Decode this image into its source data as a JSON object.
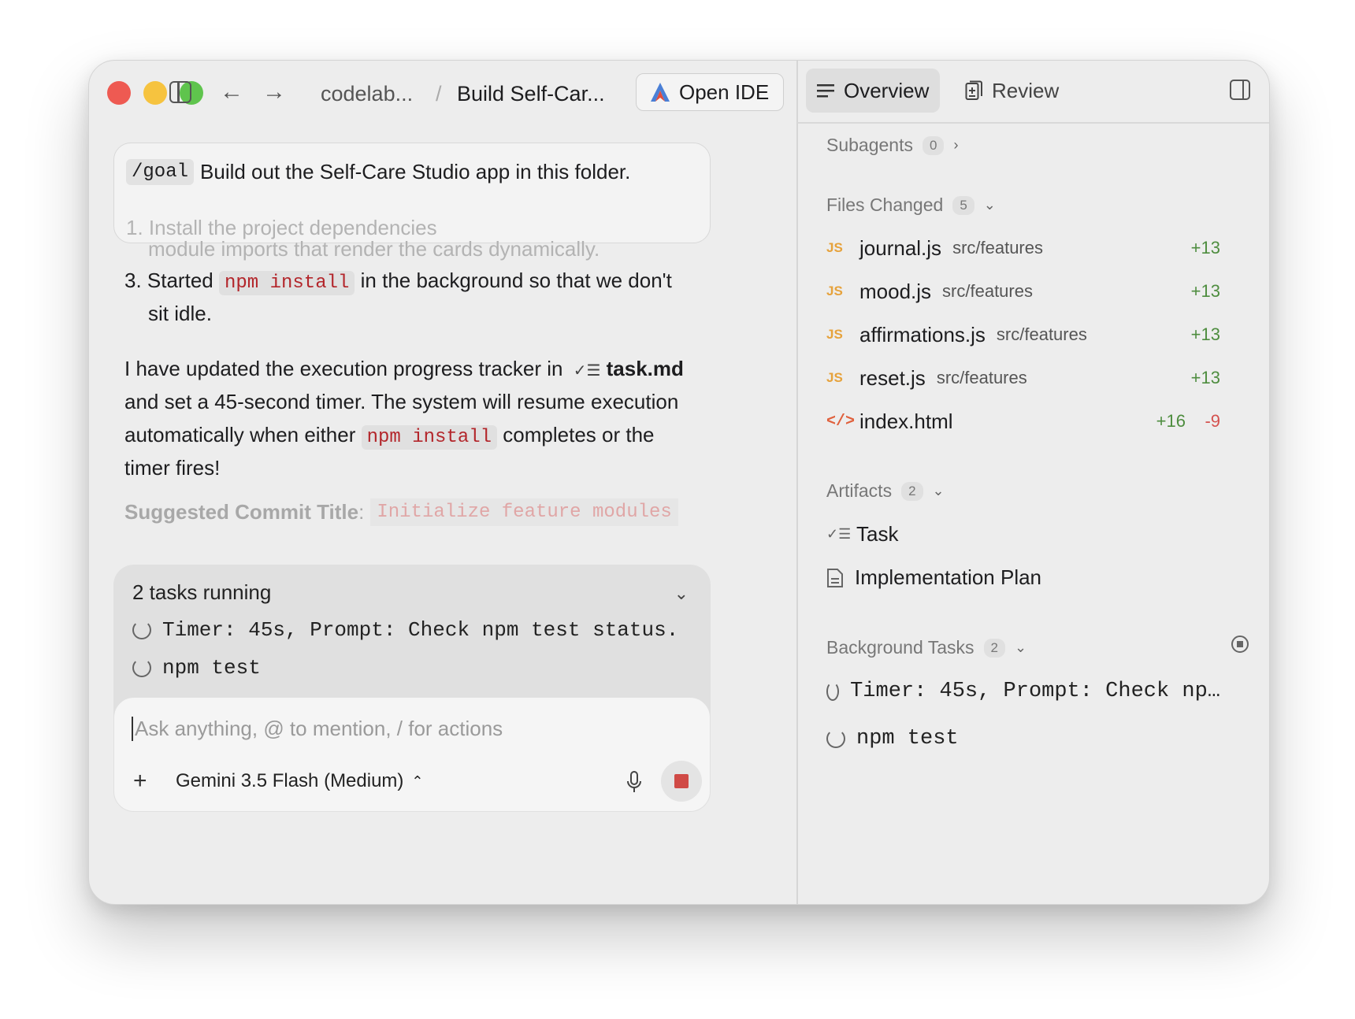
{
  "titlebar": {
    "back_icon": "arrow-left-icon",
    "forward_icon": "arrow-right-icon",
    "project": "codelab...",
    "separator": "/",
    "conversation_title": "Build Self-Car...",
    "open_ide_label": "Open IDE"
  },
  "right_tabs": {
    "overview": "Overview",
    "review": "Review"
  },
  "chat": {
    "goal_command": "/goal",
    "goal_text": "Build out the Self-Care Studio app in this folder.",
    "goal_next_line": "1. Install the project dependencies",
    "faded_line": "module imports that render the cards dynamically.",
    "step3_prefix": "3. Started",
    "step3_code": "npm install",
    "step3_suffix": "in the background so that we don't",
    "step3_cont": "sit idle.",
    "para_part1": "I have updated the execution progress tracker in",
    "para_file": "task.md",
    "para_part2": "and set a 45-second timer. The system will resume execution",
    "para_part3_prefix": "automatically when either",
    "para_code": "npm install",
    "para_part3_suffix": "completes or the",
    "para_part4": "timer fires!",
    "commit_label": "Suggested Commit Title",
    "commit_colon": ":",
    "commit_value": "Initialize feature modules"
  },
  "tasks_panel": {
    "title": "2 tasks running",
    "tasks": [
      "Timer: 45s, Prompt: Check npm test status.",
      "npm test"
    ]
  },
  "input": {
    "placeholder": "Ask anything, @ to mention, / for actions",
    "model": "Gemini 3.5 Flash (Medium)",
    "plus": "+"
  },
  "overview": {
    "subagents": {
      "label": "Subagents",
      "count": "0"
    },
    "files_changed": {
      "label": "Files Changed",
      "count": "5",
      "files": [
        {
          "icon": "JS",
          "name": "journal.js",
          "path": "src/features",
          "add": "+13",
          "del": ""
        },
        {
          "icon": "JS",
          "name": "mood.js",
          "path": "src/features",
          "add": "+13",
          "del": ""
        },
        {
          "icon": "JS",
          "name": "affirmations.js",
          "path": "src/features",
          "add": "+13",
          "del": ""
        },
        {
          "icon": "JS",
          "name": "reset.js",
          "path": "src/features",
          "add": "+13",
          "del": ""
        },
        {
          "icon": "</>",
          "name": "index.html",
          "path": "",
          "add": "+16",
          "del": "-9"
        }
      ]
    },
    "artifacts": {
      "label": "Artifacts",
      "count": "2",
      "items": [
        "Task",
        "Implementation Plan"
      ]
    },
    "background_tasks": {
      "label": "Background Tasks",
      "count": "2",
      "items": [
        "Timer: 45s, Prompt: Check np…",
        "npm test"
      ]
    }
  },
  "colors": {
    "additions": "#4e8d3f",
    "deletions": "#d4524f",
    "js_icon": "#e6a23c",
    "stop_button": "#d04a46"
  }
}
